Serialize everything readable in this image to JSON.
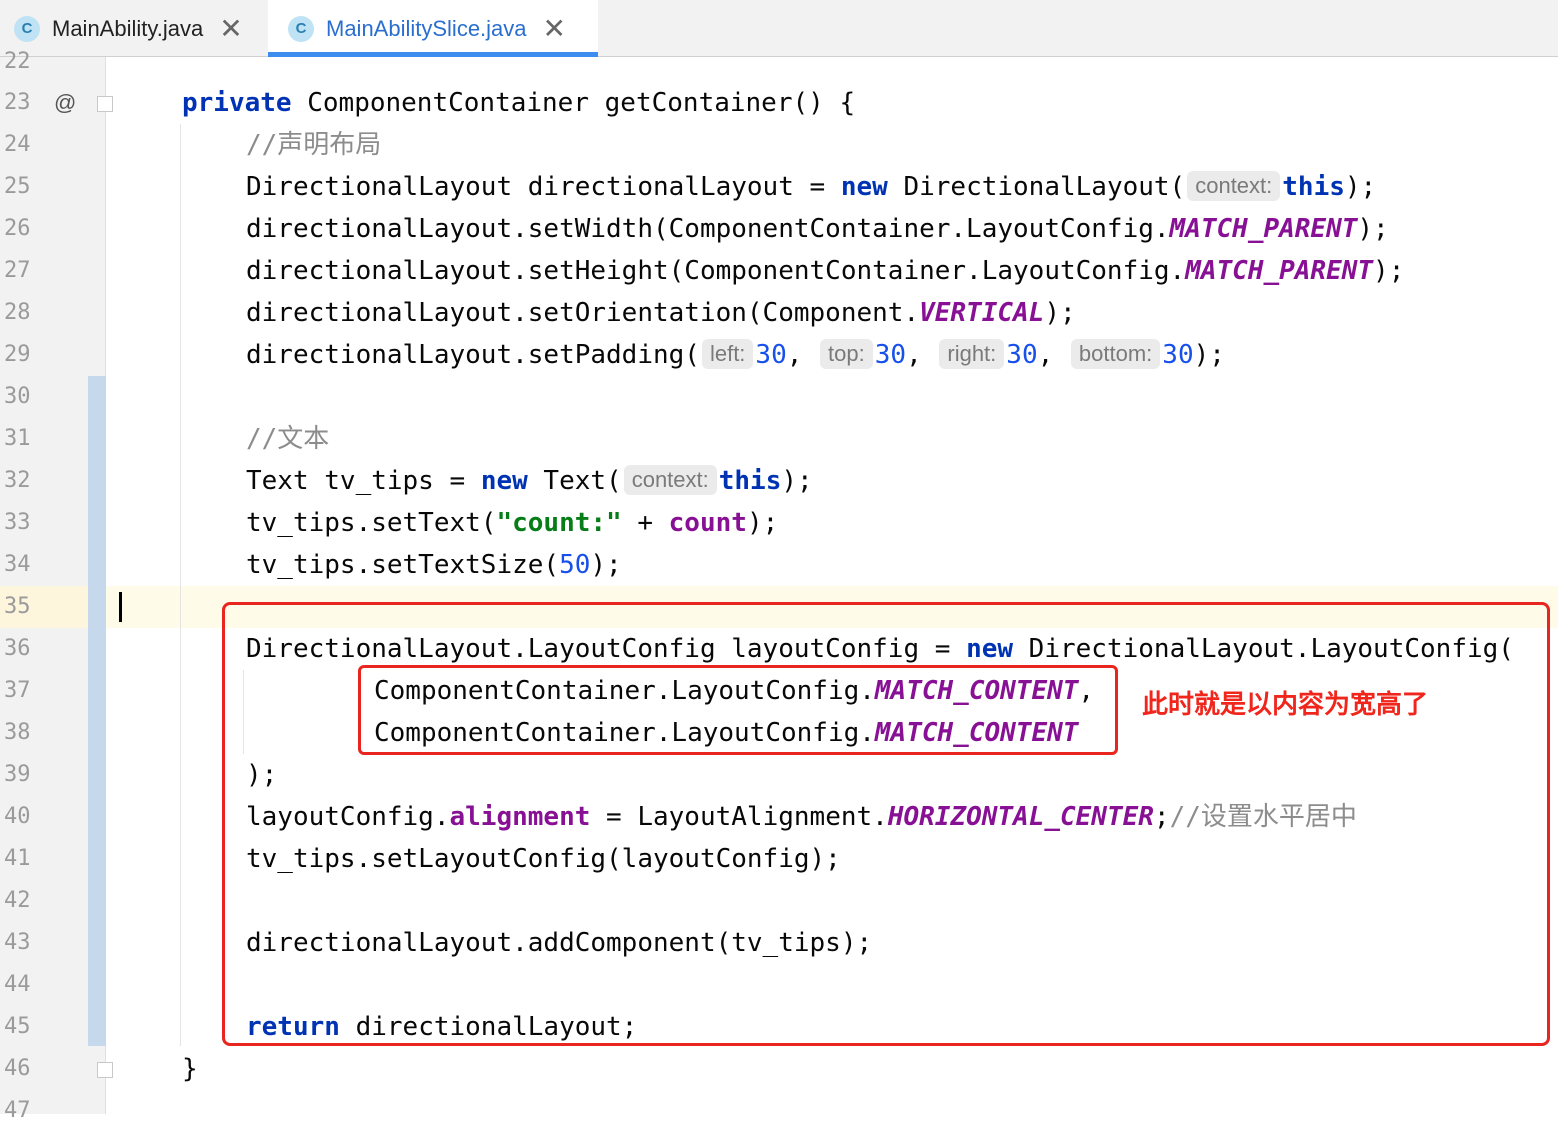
{
  "tabs": [
    {
      "icon": "C",
      "label": "MainAbility.java"
    },
    {
      "icon": "C",
      "label": "MainAbilitySlice.java",
      "active": true
    }
  ],
  "gutter": {
    "line_numbers": [
      "22",
      "23",
      "24",
      "25",
      "26",
      "27",
      "28",
      "29",
      "30",
      "31",
      "32",
      "33",
      "34",
      "35",
      "36",
      "37",
      "38",
      "39",
      "40",
      "41",
      "42",
      "43",
      "44",
      "45",
      "46",
      "47"
    ],
    "override_marker": "@",
    "current_line": "35"
  },
  "code": {
    "l23": {
      "kw": "private",
      "rest": " ComponentContainer getContainer() {"
    },
    "l24": {
      "comment": "//声明布局"
    },
    "l25": {
      "a": "DirectionalLayout directionalLayout = ",
      "kw": "new",
      "b": " DirectionalLayout(",
      "hint": "context:",
      "kw2": "this",
      "c": ");"
    },
    "l26": {
      "a": "directionalLayout.setWidth(ComponentContainer.LayoutConfig.",
      "field": "MATCH_PARENT",
      "c": ");"
    },
    "l27": {
      "a": "directionalLayout.setHeight(ComponentContainer.LayoutConfig.",
      "field": "MATCH_PARENT",
      "c": ");"
    },
    "l28": {
      "a": "directionalLayout.setOrientation(Component.",
      "field": "VERTICAL",
      "c": ");"
    },
    "l29": {
      "a": "directionalLayout.setPadding(",
      "h1": "left:",
      "n1": "30",
      "h2": "top:",
      "n2": "30",
      "h3": "right:",
      "n3": "30",
      "h4": "bottom:",
      "n4": "30",
      "c": ");"
    },
    "l31": {
      "comment": "//文本"
    },
    "l32": {
      "a": "Text tv_tips = ",
      "kw": "new",
      "b": " Text(",
      "hint": "context:",
      "kw2": "this",
      "c": ");"
    },
    "l33": {
      "a": "tv_tips.setText(",
      "str": "\"count:\"",
      "b": " + ",
      "ifield": "count",
      "c": ");"
    },
    "l34": {
      "a": "tv_tips.setTextSize(",
      "num": "50",
      "c": ");"
    },
    "l36": {
      "a": "DirectionalLayout.LayoutConfig layoutConfig = ",
      "kw": "new",
      "b": " DirectionalLayout.LayoutConfig("
    },
    "l37": {
      "a": "ComponentContainer.LayoutConfig.",
      "field": "MATCH_CONTENT",
      "c": ","
    },
    "l38": {
      "a": "ComponentContainer.LayoutConfig.",
      "field": "MATCH_CONTENT"
    },
    "l39": {
      "a": ");"
    },
    "l40": {
      "a": "layoutConfig.",
      "ifield": "alignment",
      "b": " = LayoutAlignment.",
      "field": "HORIZONTAL_CENTER",
      "c": ";",
      "comment": "//设置水平居中"
    },
    "l41": {
      "a": "tv_tips.setLayoutConfig(layoutConfig);"
    },
    "l43": {
      "a": "directionalLayout.addComponent(tv_tips);"
    },
    "l45": {
      "kw": "return",
      "a": " directionalLayout;"
    },
    "l46": {
      "a": "}"
    }
  },
  "annotation": {
    "text": "此时就是以内容为宽高了",
    "color": "#e8251f"
  },
  "colors": {
    "keyword": "#0033b3",
    "comment": "#8c8c8c",
    "string": "#067d17",
    "number": "#1750eb",
    "static_field": "#871094",
    "tab_active": "#2a6fcf"
  }
}
